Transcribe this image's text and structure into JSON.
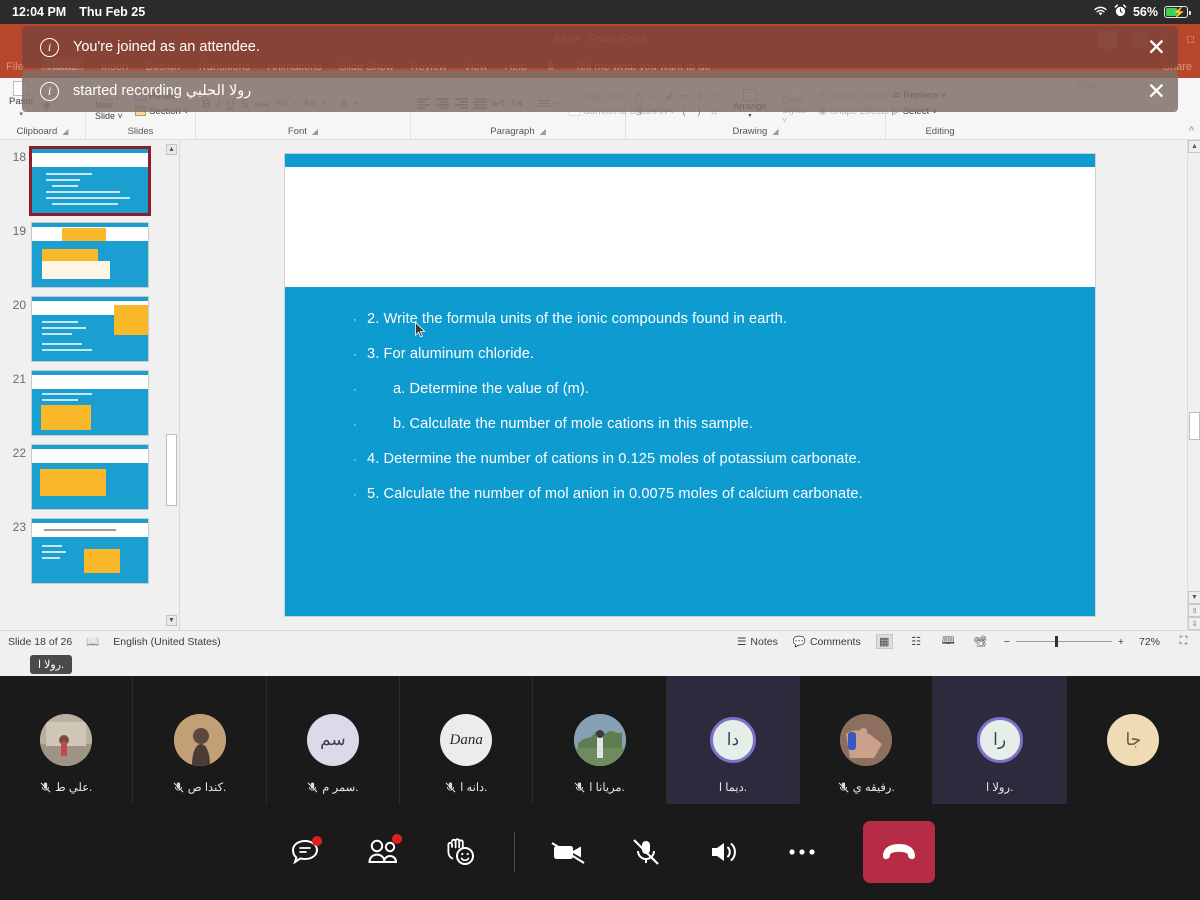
{
  "ios_status": {
    "time": "12:04 PM",
    "date": "Thu Feb 25",
    "battery_percent": "56%",
    "wifi_icon": "wifi-icon",
    "alarm_icon": "alarm-clock-icon",
    "battery_icon": "battery-charging-icon"
  },
  "notifications": [
    {
      "icon": "info-icon",
      "text": "You're joined as an attendee.",
      "close": "✕"
    },
    {
      "icon": "info-icon",
      "text": "started recording رولا الحلبي",
      "close": "✕"
    }
  ],
  "powerpoint": {
    "title": "PowerPoint",
    "autosave_label": "Save",
    "tabs": [
      "File",
      "Home",
      "Insert",
      "Design",
      "Transitions",
      "Animations",
      "Slide Show",
      "Review",
      "View",
      "Help"
    ],
    "tell_me": "Tell me what you want to do",
    "share_label": "Share",
    "find_label": "Find",
    "ribbon_groups": [
      {
        "name": "Clipboard",
        "items": [
          {
            "label": "Paste"
          },
          {
            "label": "Copy"
          },
          {
            "label": "Format Painter"
          }
        ]
      },
      {
        "name": "Slides",
        "items": [
          {
            "label": "New Slide ˅"
          },
          {
            "label": "Reset"
          },
          {
            "label": "Section ˅"
          }
        ]
      },
      {
        "name": "Font",
        "items": [
          {
            "label": "B"
          },
          {
            "label": "I"
          },
          {
            "label": "U"
          },
          {
            "label": "S"
          },
          {
            "label": "abc"
          },
          {
            "label": "AV"
          },
          {
            "label": "Aa"
          },
          {
            "label": "A"
          }
        ]
      },
      {
        "name": "Paragraph",
        "items": [
          {
            "label": "Align Text ˅"
          },
          {
            "label": "Convert to SmartArt ˅"
          }
        ]
      },
      {
        "name": "Drawing",
        "items": [
          {
            "label": "Arrange"
          },
          {
            "label": "Quick Styles ˅"
          },
          {
            "label": "Shape Outline ˅"
          },
          {
            "label": "Shape Effects ˅"
          }
        ]
      },
      {
        "name": "Editing",
        "items": [
          {
            "label": "Replace ˅"
          },
          {
            "label": "Select ˅"
          }
        ]
      }
    ],
    "thumbnails": [
      {
        "number": "18",
        "selected": true
      },
      {
        "number": "19",
        "selected": false
      },
      {
        "number": "20",
        "selected": false
      },
      {
        "number": "21",
        "selected": false
      },
      {
        "number": "22",
        "selected": false
      },
      {
        "number": "23",
        "selected": false
      }
    ],
    "slide": {
      "title": "",
      "bullets": [
        {
          "dot": "·",
          "text": "2. Write the formula units of the ionic compounds found in earth.",
          "sub": false,
          "bold_part": ""
        },
        {
          "dot": "·",
          "text": "3. For aluminum chloride.",
          "sub": false,
          "bold_part": "aluminum chloride"
        },
        {
          "dot": "·",
          "text": "a. Determine the value of (m).",
          "sub": true,
          "bold_part": ""
        },
        {
          "dot": "·",
          "text": "b. Calculate the number of mole cations in this sample.",
          "sub": true,
          "bold_part": ""
        },
        {
          "dot": "·",
          "text": "4. Determine the number of cations in 0.125 moles of potassium carbonate.",
          "sub": false,
          "bold_part": ""
        },
        {
          "dot": "·",
          "text": "5. Calculate the number of mol anion in 0.0075 moles of calcium carbonate.",
          "sub": false,
          "bold_part": ""
        }
      ]
    },
    "status_bar": {
      "slide_counter": "Slide 18 of 26",
      "slide_count_short": "26",
      "language": "English (United States)",
      "notes_label": "Notes",
      "comments_label": "Comments",
      "zoom_level": "72%",
      "views": [
        "normal-view",
        "slide-sorter-view",
        "reading-view",
        "slide-show-view"
      ],
      "tooltip": "رولا ا."
    }
  },
  "zoom_meeting": {
    "participants": [
      {
        "name": "علي ط.",
        "muted": true,
        "speaking": false,
        "avatar_type": "photo",
        "avatar_text": "",
        "avatar_bg": "#8d8678"
      },
      {
        "name": "كندا ص.",
        "muted": true,
        "speaking": false,
        "avatar_type": "photo",
        "avatar_text": "",
        "avatar_bg": "#b08a62"
      },
      {
        "name": "سمر م.",
        "muted": true,
        "speaking": false,
        "avatar_type": "initials",
        "avatar_text": "سم",
        "avatar_bg": "#ddd9e8"
      },
      {
        "name": "دانه ا.",
        "muted": true,
        "speaking": false,
        "avatar_type": "initials",
        "avatar_text": "Dana",
        "avatar_bg": "#ececec"
      },
      {
        "name": "مريانا ا.",
        "muted": true,
        "speaking": false,
        "avatar_type": "photo",
        "avatar_text": "",
        "avatar_bg": "#7e9a74"
      },
      {
        "name": "ديما ا.",
        "muted": false,
        "speaking": true,
        "avatar_type": "initials",
        "avatar_text": "دا",
        "avatar_bg": "#e6eeea"
      },
      {
        "name": "رفيقه ي.",
        "muted": true,
        "speaking": false,
        "avatar_type": "photo",
        "avatar_text": "",
        "avatar_bg": "#6d5a50"
      },
      {
        "name": "رولا ا.",
        "muted": false,
        "speaking": true,
        "avatar_type": "initials",
        "avatar_text": "را",
        "avatar_bg": "#e6eeea"
      },
      {
        "name": "",
        "muted": false,
        "speaking": false,
        "avatar_type": "initials",
        "avatar_text": "جا",
        "avatar_bg": "#efdcb4"
      }
    ],
    "toolbar": [
      {
        "name": "chat-button",
        "label": "Chat",
        "icon": "chat-bubble-icon",
        "badge": true
      },
      {
        "name": "participants-button",
        "label": "Participants",
        "icon": "people-icon",
        "badge": true
      },
      {
        "name": "reactions-button",
        "label": "Reactions",
        "icon": "raise-hand-emoji-icon",
        "badge": false
      },
      {
        "name": "video-button",
        "label": "Start Video",
        "icon": "video-off-icon",
        "badge": false
      },
      {
        "name": "mute-button",
        "label": "Unmute",
        "icon": "mic-off-icon",
        "badge": false
      },
      {
        "name": "speaker-button",
        "label": "Speaker",
        "icon": "speaker-icon",
        "badge": false
      },
      {
        "name": "more-button",
        "label": "More",
        "icon": "ellipsis-icon",
        "badge": false
      },
      {
        "name": "leave-button",
        "label": "Leave",
        "icon": "end-call-icon",
        "badge": false
      }
    ],
    "accent_color": "#7b71c9",
    "leave_color": "#b62c46"
  }
}
